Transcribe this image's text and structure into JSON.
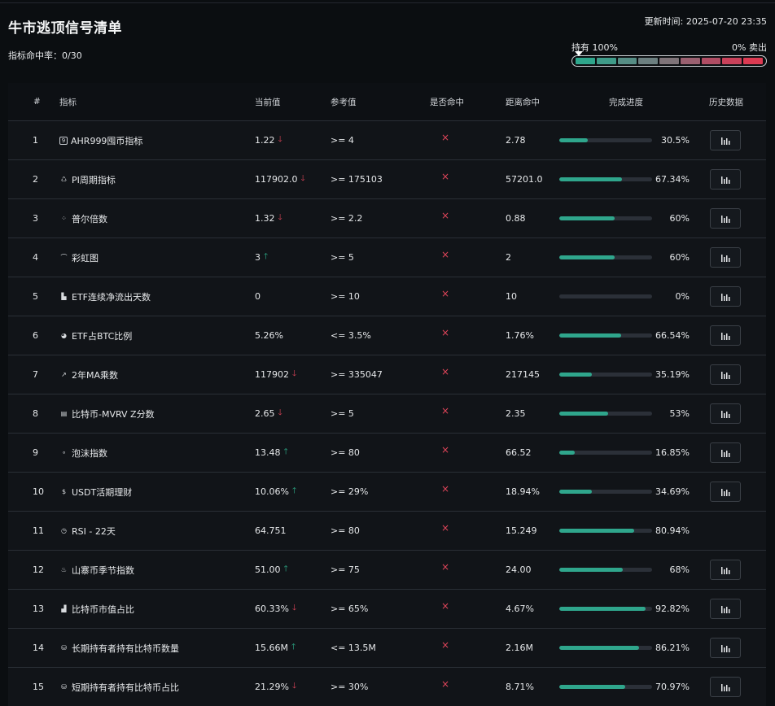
{
  "header": {
    "title": "牛市逃顶信号清单",
    "hit_rate_label": "指标命中率：",
    "hit_rate_value": "0/30",
    "update_time": "更新时间: 2025-07-20 23:35",
    "hold_label": "持有 100%",
    "sell_label": "0% 卖出"
  },
  "meter": {
    "segment_colors": [
      "#2fa68c",
      "#3f9b89",
      "#568d85",
      "#6c7f80",
      "#7f7479",
      "#9a6070",
      "#b04d64",
      "#c9415a",
      "#dc3a52"
    ]
  },
  "columns": {
    "idx": "#",
    "name": "指标",
    "current": "当前值",
    "reference": "参考值",
    "hit": "是否命中",
    "distance": "距离命中",
    "progress": "完成进度",
    "history": "历史数据"
  },
  "rows": [
    {
      "idx": "1",
      "icon": "nine-box-icon",
      "icon_glyph": "9",
      "name": "AHR999囤币指标",
      "current": "1.22",
      "trend": "down",
      "reference": ">= 4",
      "hit": "×",
      "distance": "2.78",
      "progress": 30.5,
      "progress_label": "30.5%",
      "history": true
    },
    {
      "idx": "2",
      "icon": "cycle-icon",
      "icon_glyph": "♺",
      "name": "PI周期指标",
      "current": "117902.0",
      "trend": "down",
      "reference": ">= 175103",
      "hit": "×",
      "distance": "57201.0",
      "progress": 67.34,
      "progress_label": "67.34%",
      "history": true
    },
    {
      "idx": "3",
      "icon": "scatter-icon",
      "icon_glyph": "⁘",
      "name": "普尔倍数",
      "current": "1.32",
      "trend": "down",
      "reference": ">= 2.2",
      "hit": "×",
      "distance": "0.88",
      "progress": 60,
      "progress_label": "60%",
      "history": true
    },
    {
      "idx": "4",
      "icon": "rainbow-icon",
      "icon_glyph": "⌒",
      "name": "彩虹图",
      "current": "3",
      "trend": "up",
      "reference": ">= 5",
      "hit": "×",
      "distance": "2",
      "progress": 60,
      "progress_label": "60%",
      "history": true
    },
    {
      "idx": "5",
      "icon": "bar-chart-icon",
      "icon_glyph": "▙",
      "name": "ETF连续净流出天数",
      "current": "0",
      "trend": "none",
      "reference": ">= 10",
      "hit": "×",
      "distance": "10",
      "progress": 0,
      "progress_label": "0%",
      "history": true
    },
    {
      "idx": "6",
      "icon": "pie-chart-icon",
      "icon_glyph": "◕",
      "name": "ETF占BTC比例",
      "current": "5.26%",
      "trend": "none",
      "reference": "<= 3.5%",
      "hit": "×",
      "distance": "1.76%",
      "progress": 66.54,
      "progress_label": "66.54%",
      "history": true
    },
    {
      "idx": "7",
      "icon": "line-chart-icon",
      "icon_glyph": "↗",
      "name": "2年MA乘数",
      "current": "117902",
      "trend": "down",
      "reference": ">= 335047",
      "hit": "×",
      "distance": "217145",
      "progress": 35.19,
      "progress_label": "35.19%",
      "history": true
    },
    {
      "idx": "8",
      "icon": "clipboard-icon",
      "icon_glyph": "▤",
      "name": "比特币-MVRV Z分数",
      "current": "2.65",
      "trend": "down",
      "reference": ">= 5",
      "hit": "×",
      "distance": "2.35",
      "progress": 53,
      "progress_label": "53%",
      "history": true
    },
    {
      "idx": "9",
      "icon": "bubbles-icon",
      "icon_glyph": "∘",
      "name": "泡沫指数",
      "current": "13.48",
      "trend": "up",
      "reference": ">= 80",
      "hit": "×",
      "distance": "66.52",
      "progress": 16.85,
      "progress_label": "16.85%",
      "history": true
    },
    {
      "idx": "10",
      "icon": "dollar-icon",
      "icon_glyph": "$",
      "name": "USDT活期理财",
      "current": "10.06%",
      "trend": "up",
      "reference": ">= 29%",
      "hit": "×",
      "distance": "18.94%",
      "progress": 34.69,
      "progress_label": "34.69%",
      "history": true
    },
    {
      "idx": "11",
      "icon": "clock-icon",
      "icon_glyph": "◷",
      "name": "RSI - 22天",
      "current": "64.751",
      "trend": "none",
      "reference": ">= 80",
      "hit": "×",
      "distance": "15.249",
      "progress": 80.94,
      "progress_label": "80.94%",
      "history": false
    },
    {
      "idx": "12",
      "icon": "flame-icon",
      "icon_glyph": "♨",
      "name": "山寨币季节指数",
      "current": "51.00",
      "trend": "up",
      "reference": ">= 75",
      "hit": "×",
      "distance": "24.00",
      "progress": 68,
      "progress_label": "68%",
      "history": true
    },
    {
      "idx": "13",
      "icon": "signal-bars-icon",
      "icon_glyph": "▟",
      "name": "比特币市值占比",
      "current": "60.33%",
      "trend": "down",
      "reference": ">= 65%",
      "hit": "×",
      "distance": "4.67%",
      "progress": 92.82,
      "progress_label": "92.82%",
      "history": true
    },
    {
      "idx": "14",
      "icon": "database-icon",
      "icon_glyph": "⛁",
      "name": "长期持有者持有比特币数量",
      "current": "15.66M",
      "trend": "up",
      "reference": "<= 13.5M",
      "hit": "×",
      "distance": "2.16M",
      "progress": 86.21,
      "progress_label": "86.21%",
      "history": true
    },
    {
      "idx": "15",
      "icon": "database-icon",
      "icon_glyph": "⛁",
      "name": "短期持有者持有比特币占比",
      "current": "21.29%",
      "trend": "down",
      "reference": ">= 30%",
      "hit": "×",
      "distance": "8.71%",
      "progress": 70.97,
      "progress_label": "70.97%",
      "history": true
    }
  ]
}
